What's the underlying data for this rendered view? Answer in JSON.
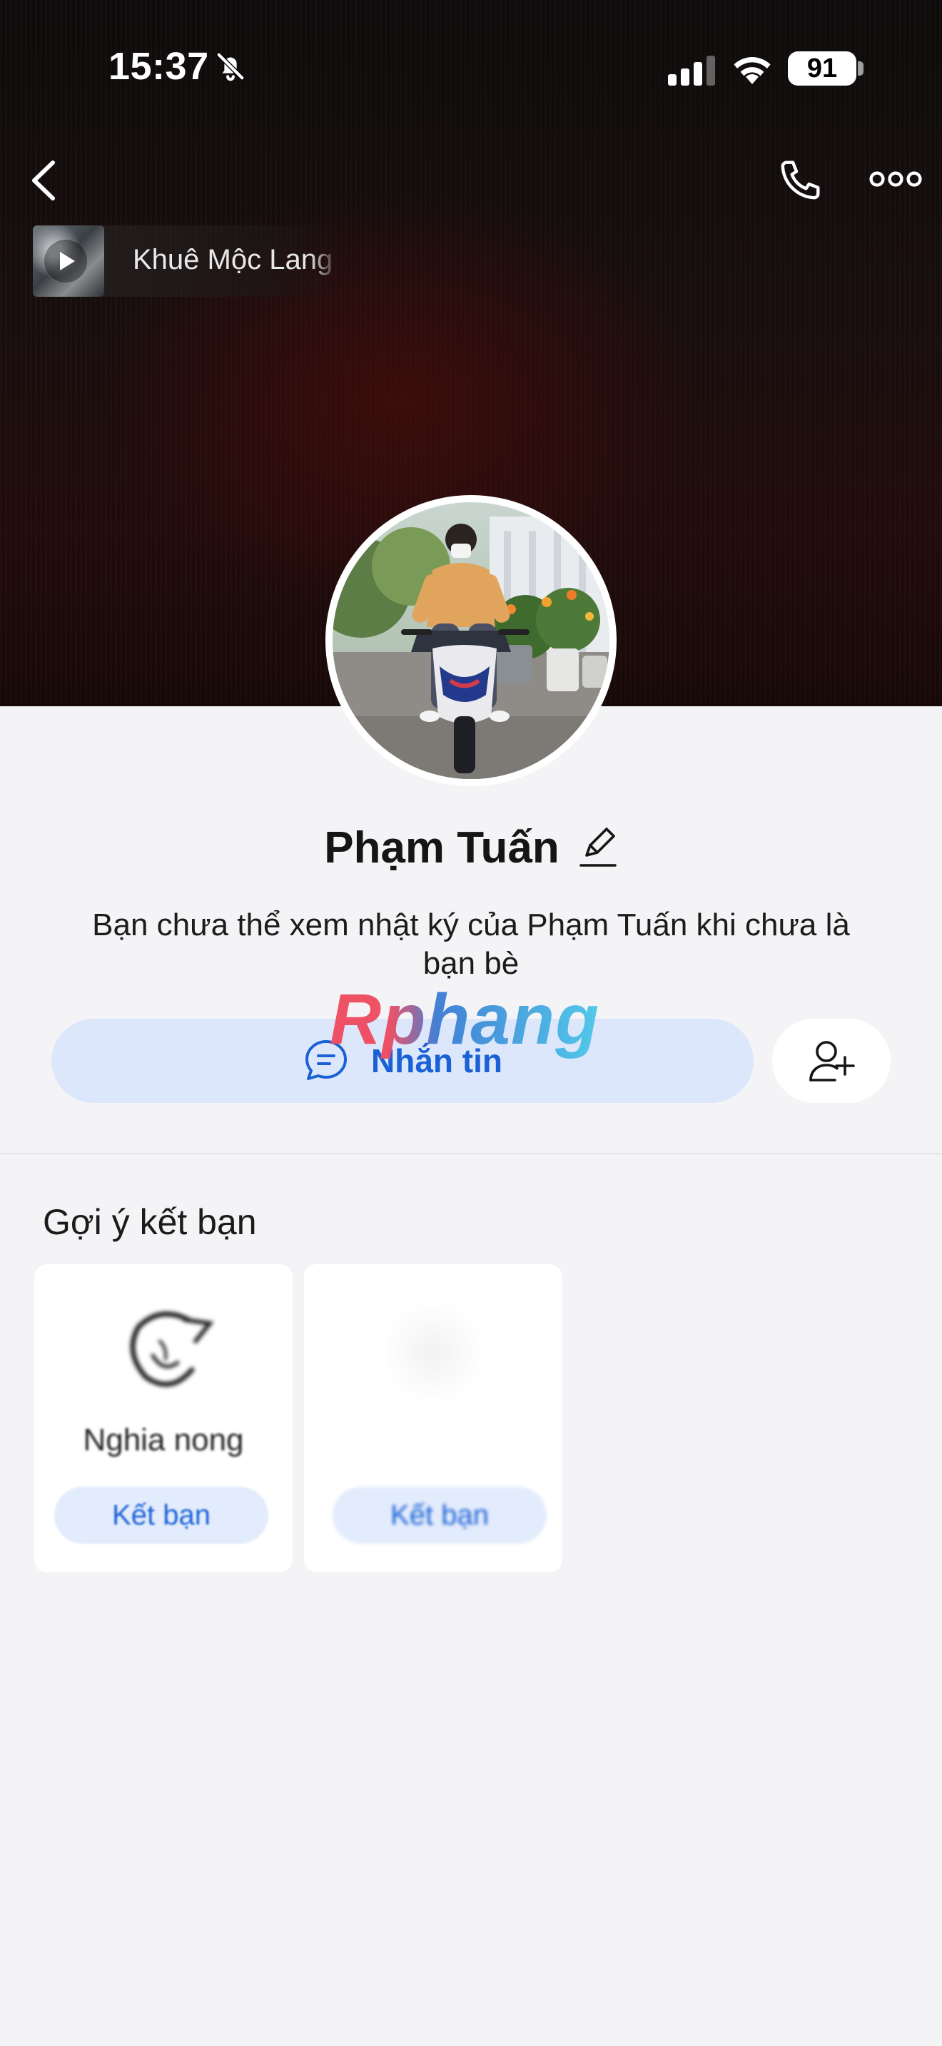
{
  "status_bar": {
    "time": "15:37",
    "battery": "91",
    "icons": [
      "bell-slash-icon",
      "cellular-signal-icon",
      "wifi-icon",
      "battery-icon"
    ]
  },
  "header": {
    "icons": [
      "back-chevron-icon",
      "phone-icon",
      "more-options-icon"
    ]
  },
  "music": {
    "title": "Khuê Mộc Lang",
    "icon": "play-icon"
  },
  "profile": {
    "name": "Phạm Tuấn",
    "notice": "Bạn chưa thể xem nhật ký của Phạm Tuấn khi chưa là bạn bè"
  },
  "actions": {
    "message_label": "Nhắn tin",
    "message_icon": "chat-bubble-icon",
    "add_friend_icon": "add-friend-icon",
    "accent_color": "#1a61d6",
    "button_bg": "#dce7fb"
  },
  "watermark": "Rphang",
  "suggestions": {
    "title": "Gợi ý kết bạn",
    "cards": [
      {
        "name": "Nghia nong",
        "button": "Kết bạn"
      },
      {
        "name": "",
        "button": "Kết bạn"
      }
    ]
  }
}
